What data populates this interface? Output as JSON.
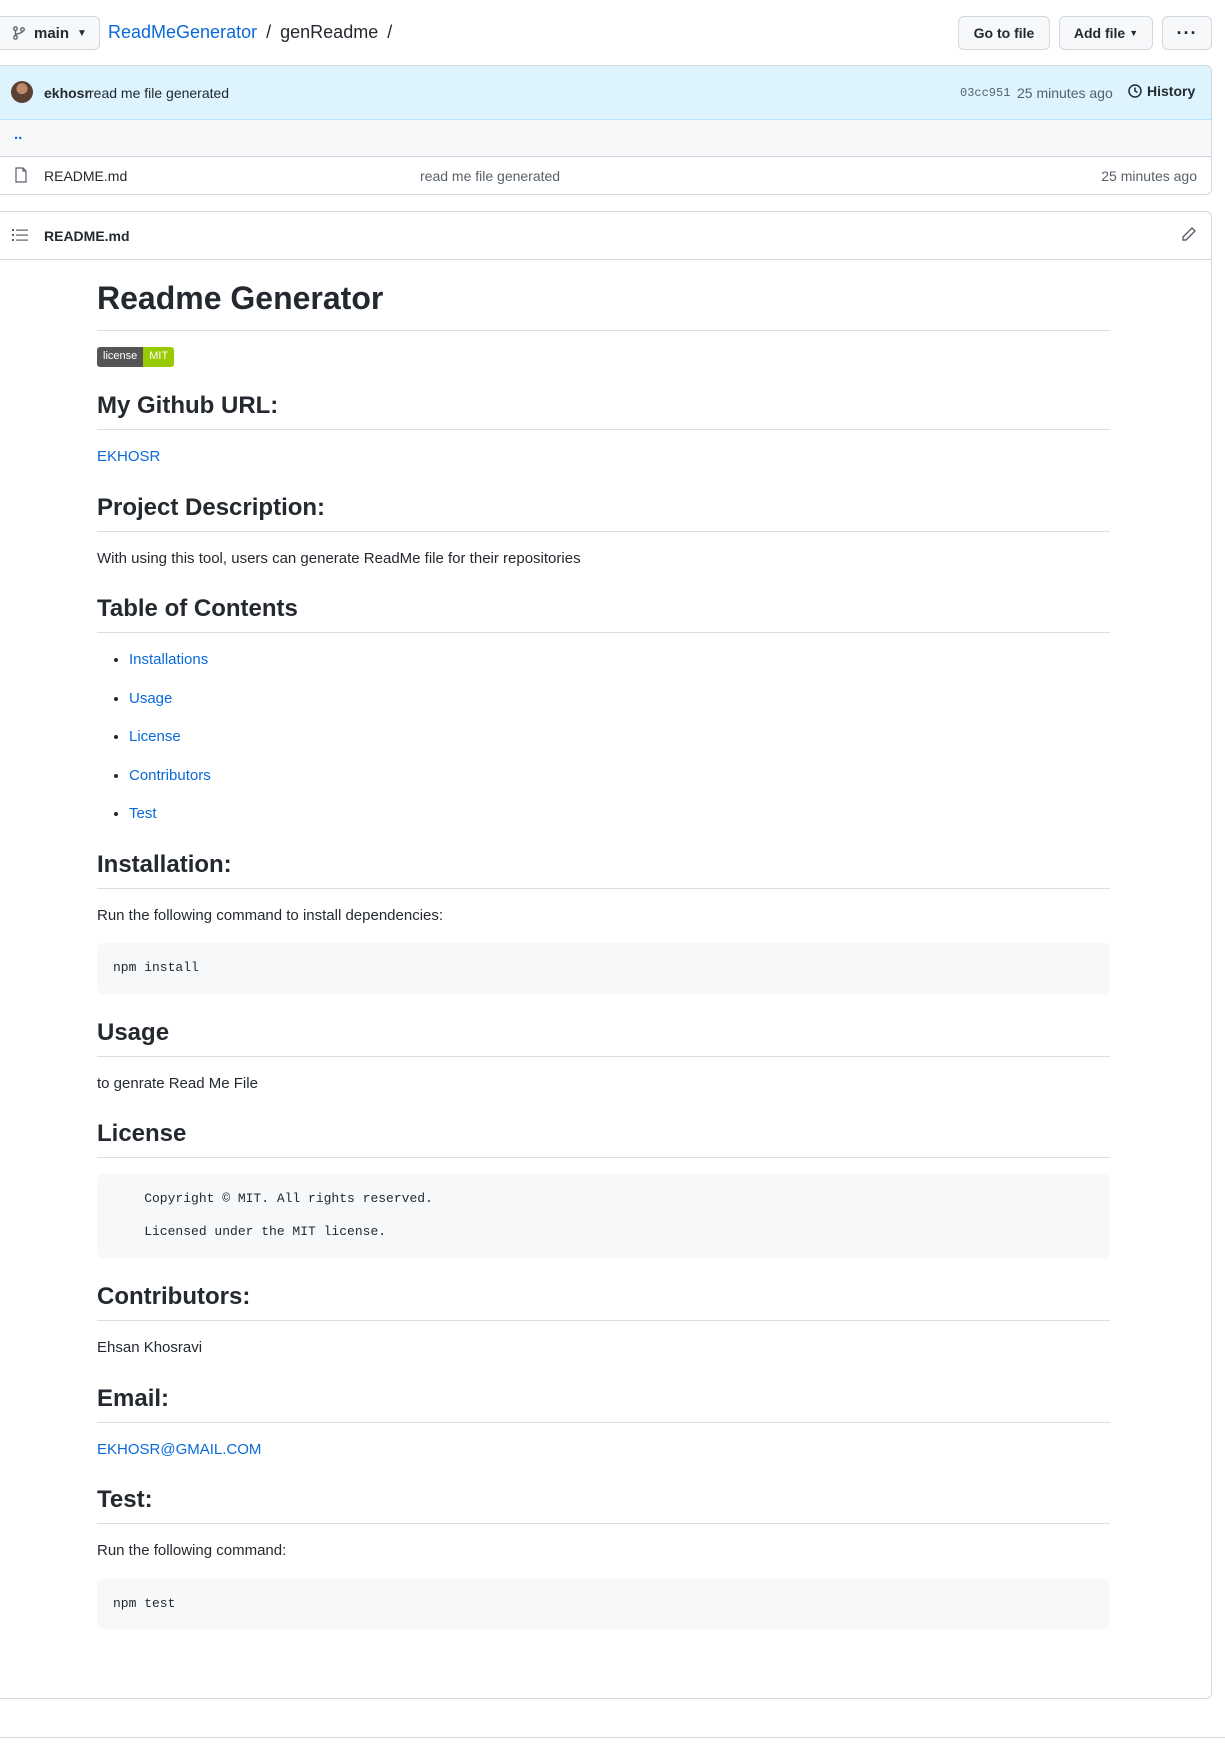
{
  "topbar": {
    "branch": "main",
    "repo": "ReadMeGenerator",
    "folder": "genReadme",
    "go_to_file": "Go to file",
    "add_file": "Add file",
    "more": "···"
  },
  "commit": {
    "author": "ekhosr",
    "message": "read me file generated",
    "sha": "03cc951",
    "time": "25 minutes ago",
    "history": "History"
  },
  "files": {
    "up": "..",
    "rows": [
      {
        "name": "README.md",
        "message": "read me file generated",
        "time": "25 minutes ago"
      }
    ]
  },
  "readme": {
    "filename": "README.md",
    "title": "Readme Generator",
    "badge": {
      "label": "license",
      "value": "MIT"
    },
    "github_heading": "My Github URL:",
    "github_link": "EKHOSR",
    "description_heading": "Project Description:",
    "description": "With using this tool, users can generate ReadMe file for their repositories",
    "toc_heading": "Table of Contents",
    "toc": [
      "Installations",
      "Usage",
      "License",
      "Contributors",
      "Test"
    ],
    "installation_heading": "Installation:",
    "installation_text": "Run the following command to install dependencies:",
    "installation_code": "npm install",
    "usage_heading": "Usage",
    "usage_text": "to genrate Read Me File",
    "license_heading": "License",
    "license_code_1": "    Copyright © MIT. All rights reserved.",
    "license_code_2": "    Licensed under the MIT license.",
    "contributors_heading": "Contributors:",
    "contributors_text": "Ehsan Khosravi",
    "email_heading": "Email:",
    "email_link": "EKHOSR@GMAIL.COM",
    "test_heading": "Test:",
    "test_text": "Run the following command:",
    "test_code": "npm test"
  },
  "colors": {
    "link": "#0969da",
    "commit_bg": "#ddf4ff",
    "badge_value": "#97ca00"
  }
}
